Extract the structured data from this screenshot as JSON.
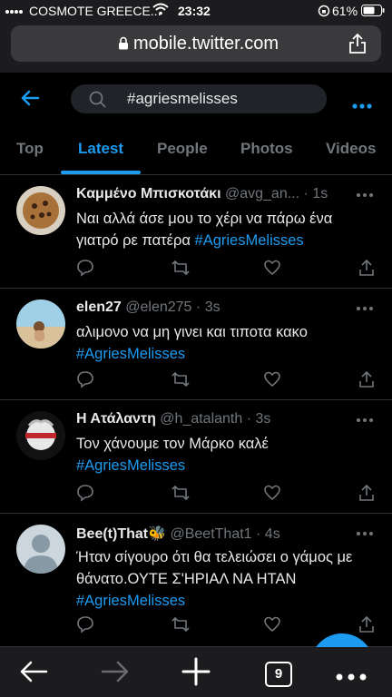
{
  "status": {
    "carrier": "COSMOTE GREECE...",
    "time": "23:32",
    "battery": "61%"
  },
  "browser": {
    "url": "mobile.twitter.com",
    "tab_count": "9"
  },
  "search": {
    "query": "#agriesmelisses"
  },
  "tabs": [
    {
      "label": "Top"
    },
    {
      "label": "Latest"
    },
    {
      "label": "People"
    },
    {
      "label": "Photos"
    },
    {
      "label": "Videos"
    }
  ],
  "active_tab": "Latest",
  "tweets": [
    {
      "name": "Καμμένο Μπισκοτάκι",
      "handle": "@avg_an...",
      "time": "1s",
      "text": "Ναι αλλά άσε μου το χέρι να πάρω ένα γιατρό ρε πατέρα",
      "hashtag": "#AgriesMelisses"
    },
    {
      "name": "elen27",
      "handle": "@elen275",
      "time": "3s",
      "text": "αλιμονο να μη γινει και τιποτα κακο",
      "hashtag": "#AgriesMelisses"
    },
    {
      "name": "Η Ατάλαντη",
      "handle": "@h_atalanth",
      "time": "3s",
      "text": "Τον χάνουμε τον Μάρκο καλέ",
      "hashtag": "#AgriesMelisses"
    },
    {
      "name": "Bee(t)That🐝",
      "handle": "@BeetThat1",
      "time": "4s",
      "text": "Ήταν σίγουρο ότι θα τελειώσει ο γάμος με θάνατο.ΟΥΤΕ Σ'ΗΡΙΑΛ ΝΑ ΗΤΑΝ",
      "hashtag": "#AgriesMelisses"
    }
  ],
  "colors": {
    "accent": "#1d9bf0",
    "background": "#000000",
    "secondary_text": "#71767b"
  }
}
